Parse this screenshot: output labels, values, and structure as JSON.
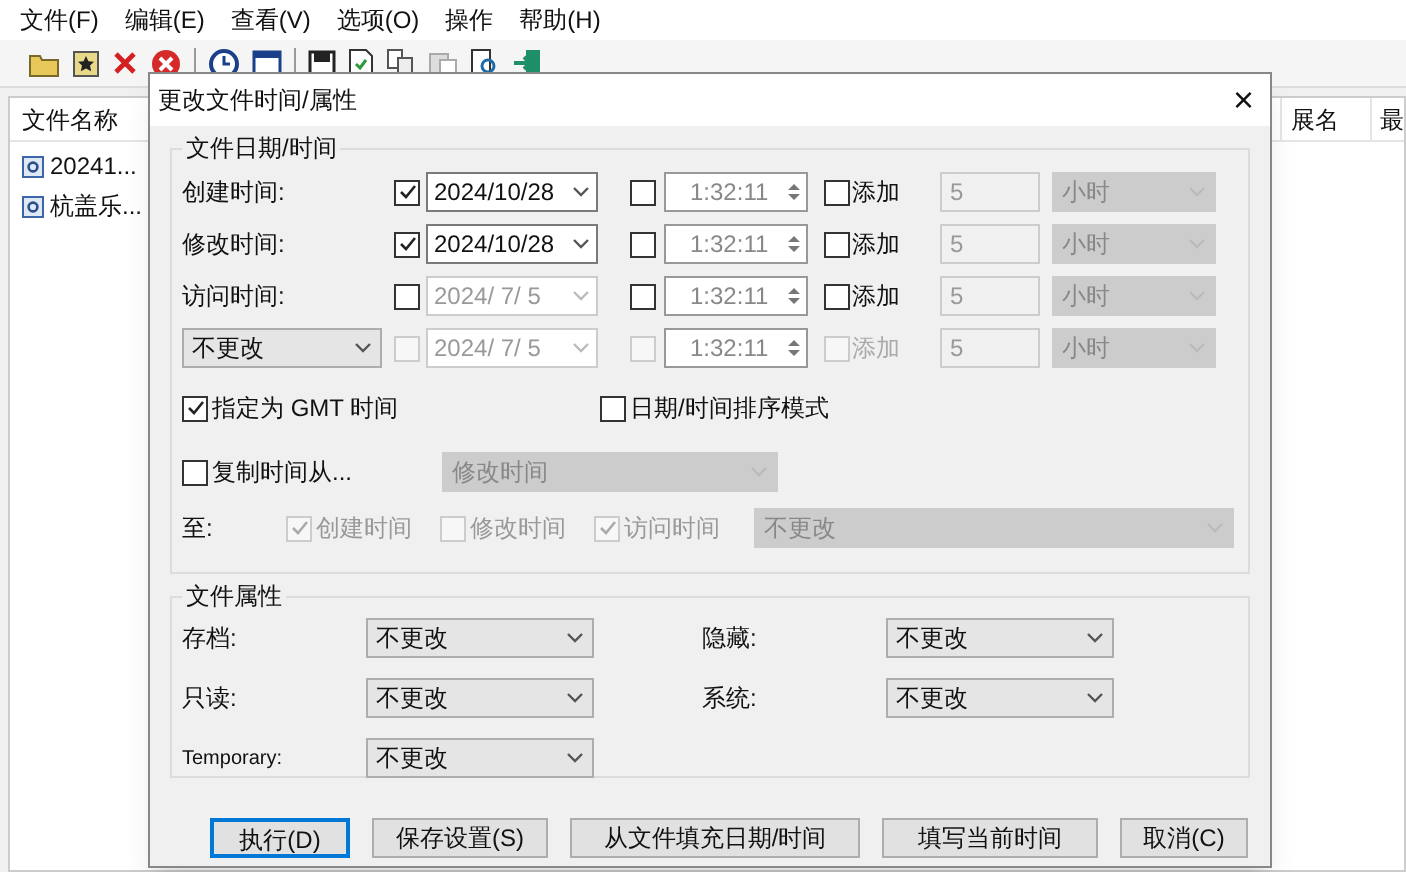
{
  "menu": [
    "文件(F)",
    "编辑(E)",
    "查看(V)",
    "选项(O)",
    "操作",
    "帮助(H)"
  ],
  "file_list": {
    "columns": [
      "文件名称",
      "展名",
      "最"
    ],
    "rows": [
      "20241...",
      "杭盖乐..."
    ]
  },
  "dialog": {
    "title": "更改文件时间/属性",
    "close": "×",
    "date_group": {
      "title": "文件日期/时间",
      "rows": [
        {
          "kind": "label",
          "label": "创建时间:",
          "disabled": false,
          "date_checked": true,
          "date": "2024/10/28",
          "time_checked": false,
          "time": "1:32:11",
          "add_checked": false,
          "add_label": "添加",
          "amount": "5",
          "unit": "小时"
        },
        {
          "kind": "label",
          "label": "修改时间:",
          "disabled": false,
          "date_checked": true,
          "date": "2024/10/28",
          "time_checked": false,
          "time": "1:32:11",
          "add_checked": false,
          "add_label": "添加",
          "amount": "5",
          "unit": "小时"
        },
        {
          "kind": "label",
          "label": "访问时间:",
          "disabled": false,
          "date_checked": false,
          "date": "2024/ 7/ 5",
          "time_checked": false,
          "time": "1:32:11",
          "add_checked": false,
          "add_label": "添加",
          "amount": "5",
          "unit": "小时"
        },
        {
          "kind": "dropdown",
          "label": "不更改",
          "disabled": true,
          "date_checked": false,
          "date": "2024/ 7/ 5",
          "time_checked": false,
          "time": "1:32:11",
          "add_checked": false,
          "add_label": "添加",
          "amount": "5",
          "unit": "小时"
        }
      ],
      "gmt": {
        "label": "指定为 GMT 时间",
        "checked": true
      },
      "sort_mode": {
        "label": "日期/时间排序模式",
        "checked": false
      },
      "copy": {
        "label": "复制时间从...",
        "checked": false,
        "source": "修改时间"
      },
      "to": {
        "label": "至:",
        "targets": [
          {
            "label": "创建时间",
            "checked": true
          },
          {
            "label": "修改时间",
            "checked": false
          },
          {
            "label": "访问时间",
            "checked": true
          }
        ],
        "mode": "不更改"
      }
    },
    "attr_group": {
      "title": "文件属性",
      "items": [
        {
          "label": "存档:",
          "value": "不更改"
        },
        {
          "label": "隐藏:",
          "value": "不更改"
        },
        {
          "label": "只读:",
          "value": "不更改"
        },
        {
          "label": "系统:",
          "value": "不更改"
        },
        {
          "label": "Temporary:",
          "value": "不更改"
        }
      ]
    },
    "buttons": [
      {
        "label": "执行(D)",
        "default": true
      },
      {
        "label": "保存设置(S)",
        "default": false
      },
      {
        "label": "从文件填充日期/时间",
        "default": false
      },
      {
        "label": "填写当前时间",
        "default": false
      },
      {
        "label": "取消(C)",
        "default": false
      }
    ]
  }
}
